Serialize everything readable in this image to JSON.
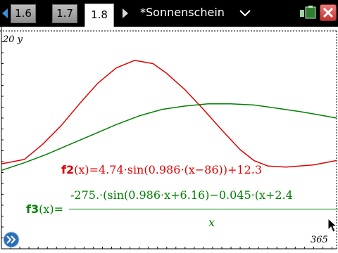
{
  "toolbar": {
    "tabs": [
      {
        "label": "1.6",
        "active": false
      },
      {
        "label": "1.7",
        "active": false
      },
      {
        "label": "1.8",
        "active": true
      }
    ],
    "document_title": "*Sonnenschein",
    "icons": {
      "prev": "triangle-left-icon",
      "next": "triangle-right-icon",
      "menu": "chevron-down-icon",
      "battery": "battery-icon",
      "close": "close-icon"
    }
  },
  "graph": {
    "y_max_label": "20 y",
    "x_max_label": "365",
    "functions": {
      "f2": {
        "name": "f2",
        "args": "(x)",
        "expression": "=4.74·sin(0.986·(x−86))+12.3",
        "color": "#e00000"
      },
      "f3": {
        "name": "f3",
        "args": "(x)",
        "equals": "=",
        "numerator": "-275.·(sin(0.986·x+6.16)−0.045·(x+2.4",
        "denominator": "x",
        "color": "#008000"
      }
    },
    "icons": {
      "expand": "double-chevron-right-icon",
      "cursor": "mouse-pointer-icon"
    }
  },
  "chart_data": {
    "type": "line",
    "xlim": [
      0,
      365
    ],
    "ylim": [
      0,
      20
    ],
    "series": [
      {
        "name": "f2",
        "color": "#e00000",
        "x": [
          0,
          25,
          45,
          65,
          85,
          105,
          125,
          145,
          165,
          180,
          200,
          220,
          240,
          260,
          275,
          290,
          310,
          340,
          365
        ],
        "y": [
          7.8,
          8.2,
          9.6,
          11.3,
          13.3,
          15.2,
          16.6,
          17.3,
          17.0,
          16.1,
          14.6,
          12.8,
          10.9,
          9.1,
          8.1,
          7.6,
          7.5,
          7.7,
          8.1
        ]
      },
      {
        "name": "f3",
        "color": "#008000",
        "x": [
          0,
          25,
          50,
          75,
          100,
          125,
          150,
          175,
          200,
          225,
          250,
          275,
          300,
          325,
          345,
          365
        ],
        "y": [
          7.2,
          7.9,
          8.7,
          9.6,
          10.5,
          11.4,
          12.2,
          12.8,
          13.1,
          13.3,
          13.3,
          13.2,
          12.9,
          12.6,
          12.3,
          12.0
        ]
      }
    ]
  }
}
